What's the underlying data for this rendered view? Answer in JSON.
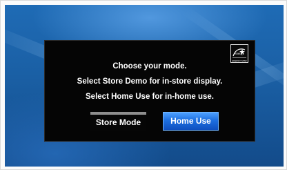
{
  "dialog": {
    "line1": "Choose your mode.",
    "line2": "Select Store Demo for in-store display.",
    "line3": "Select Home Use for in-home use."
  },
  "buttons": {
    "store_mode": "Store Mode",
    "home_use": "Home Use",
    "selected": "home_use"
  },
  "logo": {
    "icon": "energy-star-icon",
    "text": "ENERGY STAR"
  },
  "colors": {
    "background_blue": "#1a5fa4",
    "dialog_bg": "#050505",
    "selected_button": "#1d6fe0"
  }
}
